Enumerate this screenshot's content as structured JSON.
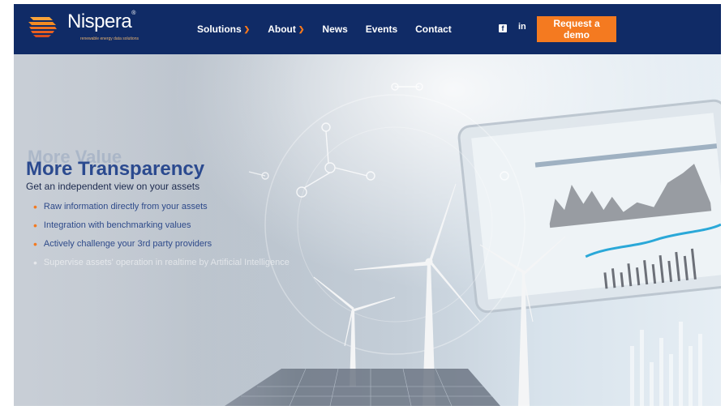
{
  "brand": {
    "name": "Nispera",
    "reg": "®",
    "tagline": "renewable energy data solutions"
  },
  "nav": {
    "items": [
      {
        "label": "Solutions",
        "has_dropdown": true
      },
      {
        "label": "About",
        "has_dropdown": true
      },
      {
        "label": "News",
        "has_dropdown": false
      },
      {
        "label": "Events",
        "has_dropdown": false
      },
      {
        "label": "Contact",
        "has_dropdown": false
      }
    ],
    "facebook_glyph": "f",
    "linkedin_label": "in",
    "cta_label": "Request a demo"
  },
  "hero": {
    "ghost_title": "More Value",
    "title": "More Transparency",
    "subtitle": "Get an independent view on your assets",
    "bullets": [
      "Raw information directly from your assets",
      "Integration with benchmarking values",
      "Actively challenge your 3rd party providers"
    ],
    "faded_bullet": "Supervise assets' operation in realtime by Artificial Intelligence"
  },
  "colors": {
    "header_bg": "#102b66",
    "accent": "#f47a20",
    "title": "#2b4a8f"
  }
}
